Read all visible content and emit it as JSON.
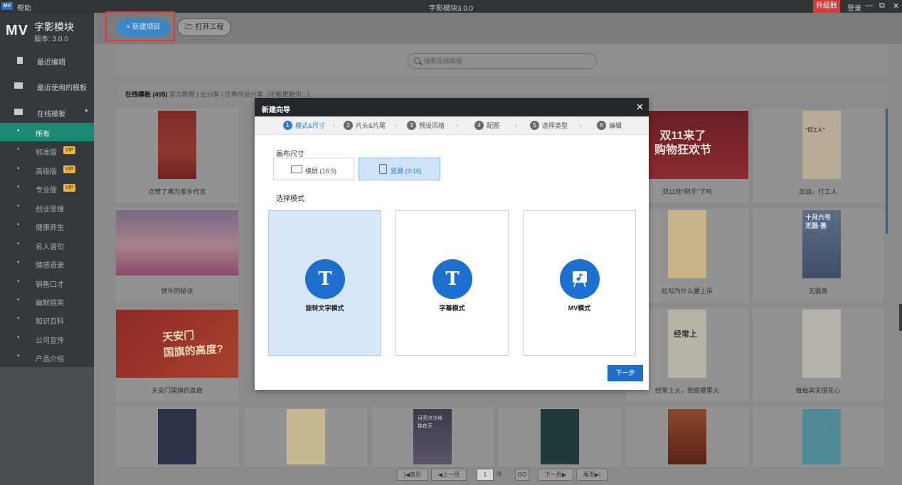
{
  "titlebar": {
    "logo": "MV",
    "help": "帮助",
    "title": "字影模块3.0.0",
    "upgrade": "升级账户",
    "login": "登录",
    "minimize": "—",
    "restore": "⧉",
    "close": "✕"
  },
  "brand": {
    "mv": "MV",
    "name": "字影模块",
    "version": "版本: 3.0.0"
  },
  "sidebar": {
    "recent_edit": "最近编辑",
    "recent_templates": "最近使用的模板",
    "online_templates": "在线模板",
    "categories": [
      "所有",
      "标准版",
      "高级版",
      "专业版",
      "创业思维",
      "健康养生",
      "名人语句",
      "情感语录",
      "销售口才",
      "幽默搞笑",
      "知识百科",
      "公司宣传",
      "产品介绍"
    ],
    "vip_label": "VIP"
  },
  "toolbar": {
    "new_project": "+  新建项目",
    "open_project": "打开工程"
  },
  "search": {
    "placeholder": "搜索在线模板"
  },
  "filters": {
    "current": "在线模板 (495)",
    "rest": "官方教程  |  云分享  |  优秀作品分享（不断更新中...）"
  },
  "cards": {
    "r1c1": "点赞丁真为家乡代言",
    "r1c5": "双11你\"剁手\"了吗",
    "r1c6": "加油，打工人",
    "r2c1": "快乐的秘诀",
    "r2c5": "拉勾为什么要上吊",
    "r2c6": "无猖善",
    "r3c1": "天安门国旗的高度",
    "r3c5": "经常上火，到底哪里火",
    "r3c6": "每每其实很花心"
  },
  "thumb_text": {
    "double11": "双11来了\n购物狂欢节",
    "tiananmen": "天安门\n国旗的高度?",
    "worker": "\"打工人\"",
    "tenth": "十月六号\n无猖·善",
    "fire": "经常上",
    "sky": "月亮冷冷地\n挂在天"
  },
  "pager": {
    "first": "|◀首页",
    "prev": "◀上一页",
    "page": "1",
    "total": "/9",
    "go": "GO",
    "next": "下一页▶",
    "last": "尾页▶|"
  },
  "dialog": {
    "title": "新建向导",
    "close": "✕",
    "steps": [
      {
        "num": "1",
        "label": "模式&尺寸"
      },
      {
        "num": "2",
        "label": "片头&片尾"
      },
      {
        "num": "3",
        "label": "预设风格"
      },
      {
        "num": "4",
        "label": "配图"
      },
      {
        "num": "5",
        "label": "选择类型"
      },
      {
        "num": "6",
        "label": "编辑"
      }
    ],
    "canvas_label": "画布尺寸",
    "landscape": "横屏 (16:9)",
    "portrait": "竖屏 (9:16)",
    "mode_label": "选择模式",
    "modes": [
      "旋转文字模式",
      "字幕模式",
      "MV模式"
    ],
    "next": "下一步"
  },
  "colors": {
    "accent": "#1d6fd0",
    "sidebar_active": "#1a8a75",
    "highlight": "#e23a3a",
    "upgrade": "#d23c3c"
  }
}
